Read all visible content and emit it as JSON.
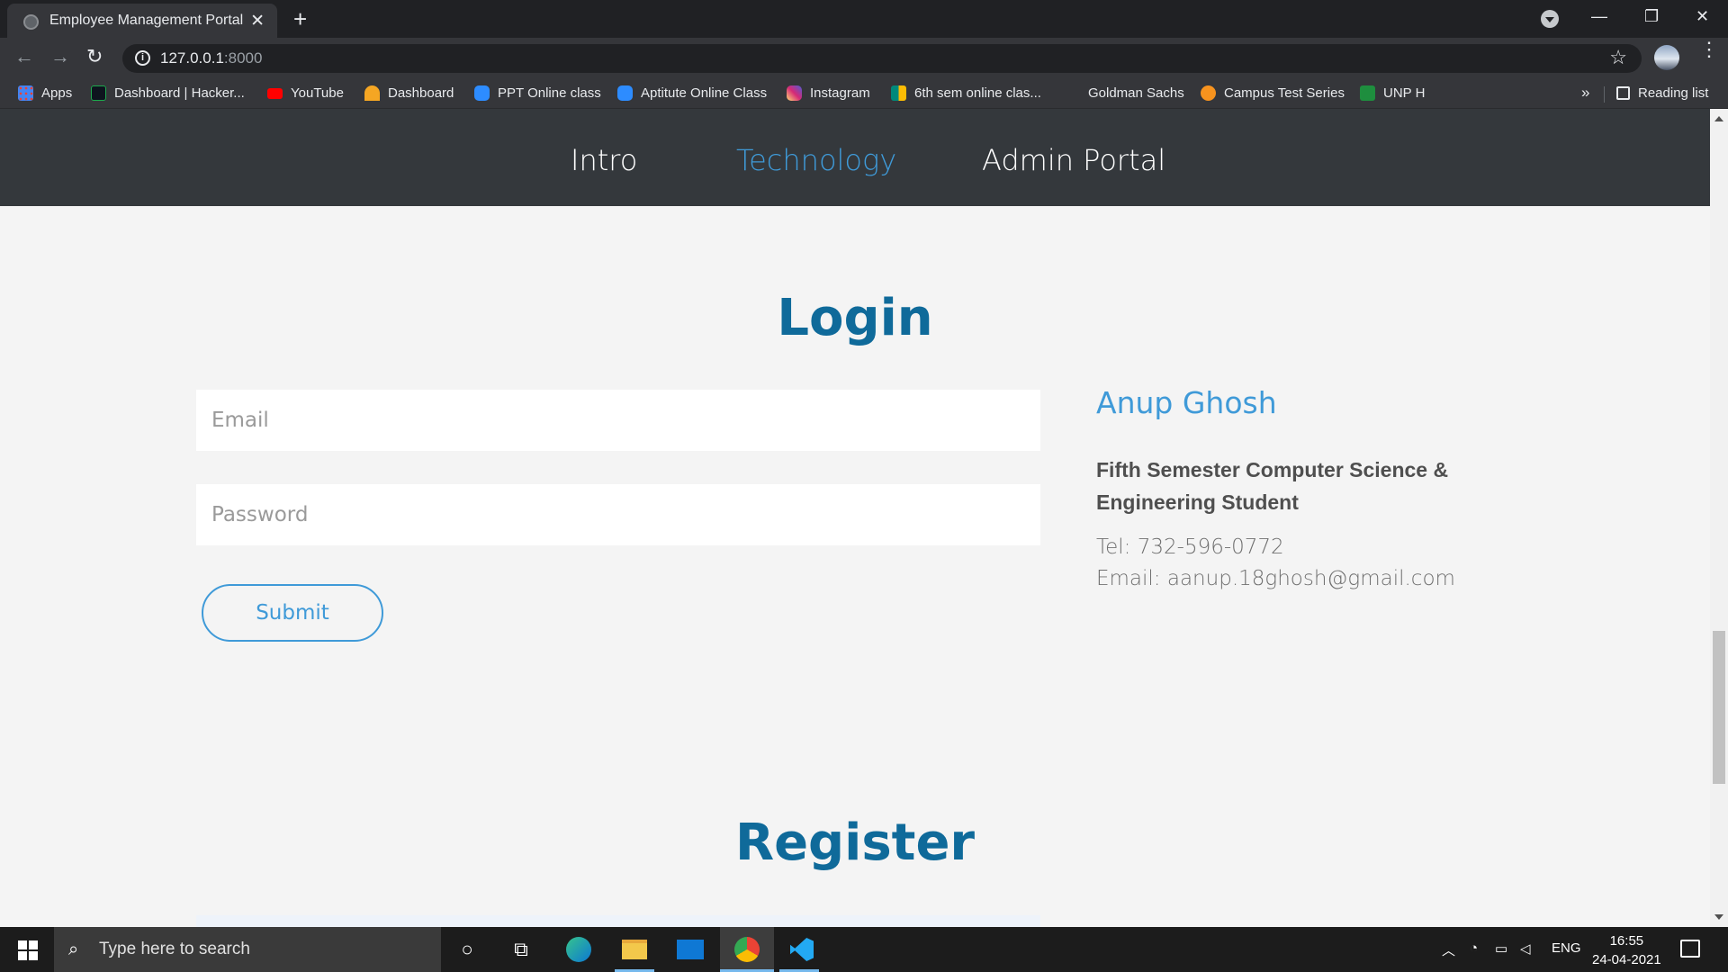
{
  "browser": {
    "tab_title": "Employee Management Portal",
    "url_host": "127.0.0.1",
    "url_port": ":8000",
    "bookmarks": [
      {
        "label": "Apps",
        "icon": "apps-grid-icon",
        "color": "#4285f4"
      },
      {
        "label": "Dashboard | Hacker...",
        "icon": "hackerrank-icon",
        "color": "#1ba94c"
      },
      {
        "label": "YouTube",
        "icon": "youtube-icon",
        "color": "#ff0000"
      },
      {
        "label": "Dashboard",
        "icon": "dashboard-icon",
        "color": "#f5a623"
      },
      {
        "label": "PPT Online class",
        "icon": "zoom-icon",
        "color": "#2d8cff"
      },
      {
        "label": "Aptitute Online Class",
        "icon": "zoom-icon",
        "color": "#2d8cff"
      },
      {
        "label": "Instagram",
        "icon": "instagram-icon",
        "color": "#d62976"
      },
      {
        "label": "6th sem online clas...",
        "icon": "meet-icon",
        "color": "#00897b"
      },
      {
        "label": "Goldman Sachs",
        "icon": "",
        "color": ""
      },
      {
        "label": "Campus Test Series",
        "icon": "campus-icon",
        "color": "#f7931e"
      },
      {
        "label": "UNP H",
        "icon": "classroom-icon",
        "color": "#1e8e3e"
      }
    ],
    "more_bookmarks": "»",
    "reading_list": "Reading list"
  },
  "site": {
    "nav": [
      {
        "label": "Intro",
        "active": false
      },
      {
        "label": "Technology",
        "active": true
      },
      {
        "label": "Admin Portal",
        "active": false
      }
    ],
    "login": {
      "title": "Login",
      "email_placeholder": "Email",
      "password_placeholder": "Password",
      "submit_label": "Submit"
    },
    "contact": {
      "name": "Anup Ghosh",
      "description": "Fifth Semester Computer Science & Engineering Student",
      "tel": "Tel: 732-596-0772",
      "email": "Email: aanup.18ghosh@gmail.com"
    },
    "register": {
      "title": "Register"
    }
  },
  "taskbar": {
    "search_placeholder": "Type here to search",
    "language": "ENG",
    "time": "16:55",
    "date": "24-04-2021"
  },
  "colors": {
    "accent": "#3f9ad8",
    "heading": "#0f6a9a",
    "nav_bg": "#34383c"
  }
}
